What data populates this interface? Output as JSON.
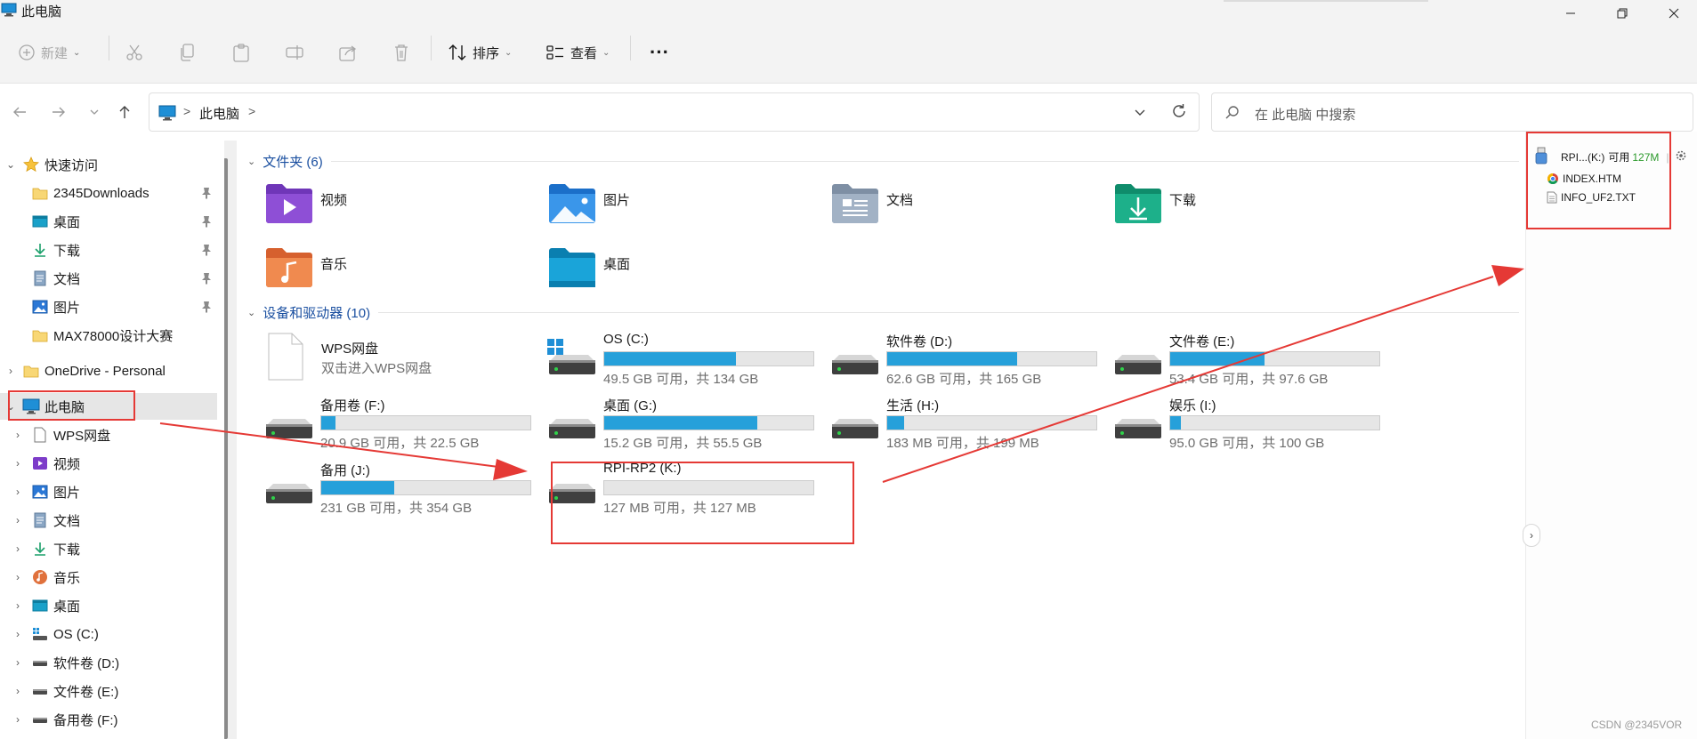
{
  "window": {
    "title": "此电脑"
  },
  "commands": {
    "new": "新建",
    "sort": "排序",
    "view": "查看",
    "more": "···"
  },
  "address": {
    "crumb": "此电脑",
    "separator": ">",
    "search_placeholder": "在 此电脑 中搜索"
  },
  "sidebar": {
    "quick_access": "快速访问",
    "quick_items": [
      {
        "label": "2345Downloads",
        "icon": "folder-icon",
        "pinned": true
      },
      {
        "label": "桌面",
        "icon": "desktop-icon",
        "pinned": true
      },
      {
        "label": "下载",
        "icon": "download-icon",
        "pinned": true
      },
      {
        "label": "文档",
        "icon": "document-icon",
        "pinned": true
      },
      {
        "label": "图片",
        "icon": "picture-icon",
        "pinned": true
      },
      {
        "label": "MAX78000设计大赛",
        "icon": "folder-icon",
        "pinned": false
      }
    ],
    "onedrive": "OneDrive - Personal",
    "this_pc": "此电脑",
    "pc_children": [
      {
        "label": "WPS网盘",
        "icon": "file-icon"
      },
      {
        "label": "视频",
        "icon": "video-icon"
      },
      {
        "label": "图片",
        "icon": "picture-icon"
      },
      {
        "label": "文档",
        "icon": "document-icon"
      },
      {
        "label": "下载",
        "icon": "download-icon"
      },
      {
        "label": "音乐",
        "icon": "music-icon"
      },
      {
        "label": "桌面",
        "icon": "desktop-icon"
      },
      {
        "label": "OS (C:)",
        "icon": "os-drive-icon"
      },
      {
        "label": "软件卷 (D:)",
        "icon": "drive-icon"
      },
      {
        "label": "文件卷 (E:)",
        "icon": "drive-icon"
      },
      {
        "label": "备用卷 (F:)",
        "icon": "drive-icon"
      }
    ]
  },
  "main": {
    "folders_header": "文件夹 (6)",
    "folders": [
      {
        "name": "视频",
        "icon": "video-folder-icon"
      },
      {
        "name": "图片",
        "icon": "pictures-folder-icon"
      },
      {
        "name": "文档",
        "icon": "documents-folder-icon"
      },
      {
        "name": "下载",
        "icon": "downloads-folder-icon"
      },
      {
        "name": "音乐",
        "icon": "music-folder-icon"
      },
      {
        "name": "桌面",
        "icon": "desktop-folder-icon"
      }
    ],
    "devices_header": "设备和驱动器 (10)",
    "wps": {
      "name": "WPS网盘",
      "sub": "双击进入WPS网盘"
    },
    "drives": [
      {
        "name": "OS (C:)",
        "cap": "49.5 GB 可用，共 134 GB",
        "used": 0.63,
        "os": true
      },
      {
        "name": "软件卷 (D:)",
        "cap": "62.6 GB 可用，共 165 GB",
        "used": 0.62
      },
      {
        "name": "文件卷 (E:)",
        "cap": "53.4 GB 可用，共 97.6 GB",
        "used": 0.45
      },
      {
        "name": "备用卷 (F:)",
        "cap": "20.9 GB 可用，共 22.5 GB",
        "used": 0.07
      },
      {
        "name": "桌面 (G:)",
        "cap": "15.2 GB 可用，共 55.5 GB",
        "used": 0.73
      },
      {
        "name": "生活 (H:)",
        "cap": "183 MB 可用，共 199 MB",
        "used": 0.08
      },
      {
        "name": "娱乐 (I:)",
        "cap": "95.0 GB 可用，共 100 GB",
        "used": 0.05
      },
      {
        "name": "备用 (J:)",
        "cap": "231 GB 可用，共 354 GB",
        "used": 0.35
      },
      {
        "name": "RPI-RP2 (K:)",
        "cap": "127 MB 可用，共 127 MB",
        "used": 0.0
      }
    ]
  },
  "popup": {
    "drive": "RPI...(K:)",
    "free_label": "可用",
    "free_value": "127M",
    "files": [
      "INDEX.HTM",
      "INFO_UF2.TXT"
    ]
  },
  "watermark": "CSDN @2345VOR",
  "colors": {
    "accent": "#26a0da",
    "annotation": "#e53935",
    "group_header": "#1a4fa0"
  }
}
